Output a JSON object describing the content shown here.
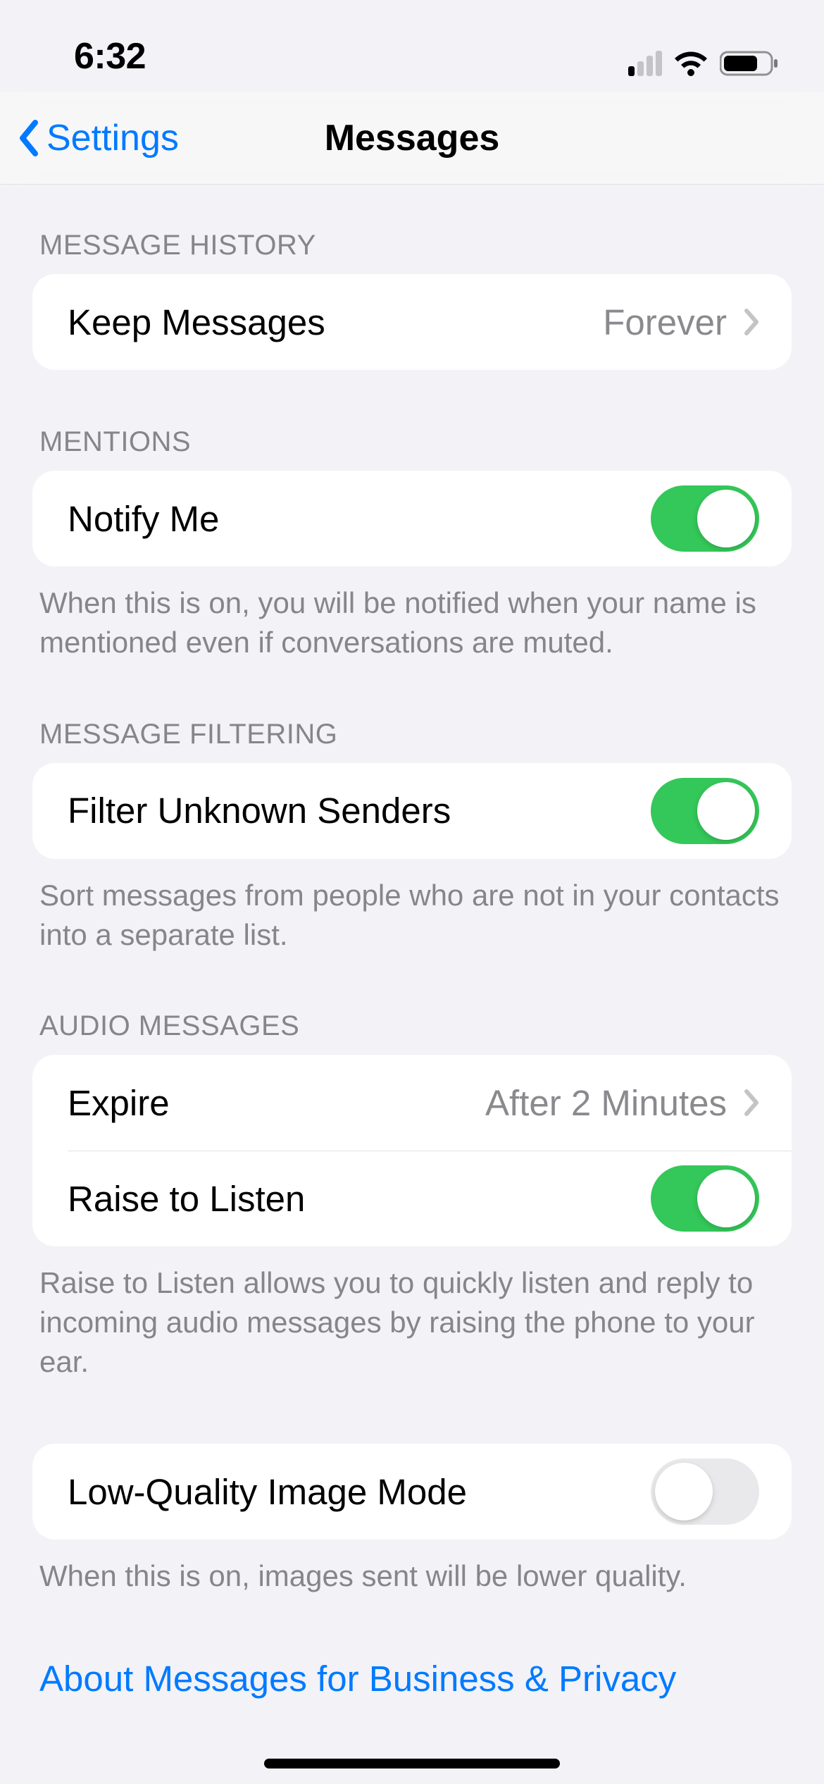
{
  "status_bar": {
    "time": "6:32"
  },
  "nav": {
    "back_label": "Settings",
    "title": "Messages"
  },
  "sections": {
    "message_history": {
      "header": "MESSAGE HISTORY",
      "keep_messages": {
        "label": "Keep Messages",
        "value": "Forever"
      }
    },
    "mentions": {
      "header": "MENTIONS",
      "notify_me": {
        "label": "Notify Me",
        "on": true
      },
      "footer": "When this is on, you will be notified when your name is mentioned even if conversations are muted."
    },
    "message_filtering": {
      "header": "MESSAGE FILTERING",
      "filter_unknown": {
        "label": "Filter Unknown Senders",
        "on": true
      },
      "footer": "Sort messages from people who are not in your contacts into a separate list."
    },
    "audio_messages": {
      "header": "AUDIO MESSAGES",
      "expire": {
        "label": "Expire",
        "value": "After 2 Minutes"
      },
      "raise_to_listen": {
        "label": "Raise to Listen",
        "on": true
      },
      "footer": "Raise to Listen allows you to quickly listen and reply to incoming audio messages by raising the phone to your ear."
    },
    "low_quality": {
      "label": "Low-Quality Image Mode",
      "on": false,
      "footer": "When this is on, images sent will be lower quality."
    },
    "about_link": "About Messages for Business & Privacy"
  }
}
